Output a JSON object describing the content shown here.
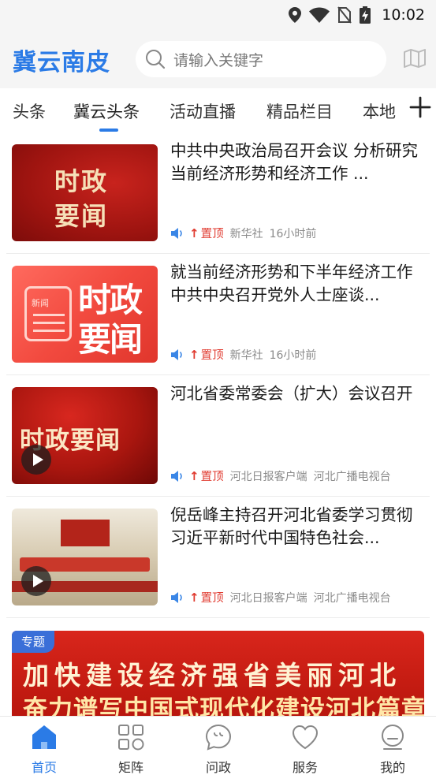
{
  "status_bar": {
    "time": "10:02"
  },
  "header": {
    "app_title": "冀云南皮",
    "search_placeholder": "请输入关键字"
  },
  "tabs": [
    {
      "label": "头条"
    },
    {
      "label": "冀云头条",
      "active": true
    },
    {
      "label": "活动直播"
    },
    {
      "label": "精品栏目"
    },
    {
      "label": "本地"
    }
  ],
  "news": [
    {
      "title": "中共中央政治局召开会议 分析研究当前经济形势和经济工作 ...",
      "thumb_text": [
        "时政",
        "要闻"
      ],
      "pin_label": "置顶",
      "sources": [
        "新华社",
        "16小时前"
      ]
    },
    {
      "title": "就当前经济形势和下半年经济工作 中共中央召开党外人士座谈...",
      "thumb_text": [
        "新闻",
        "时政",
        "要闻"
      ],
      "pin_label": "置顶",
      "sources": [
        "新华社",
        "16小时前"
      ]
    },
    {
      "title": "河北省委常委会（扩大）会议召开",
      "thumb_text": [
        "时政要闻"
      ],
      "pin_label": "置顶",
      "sources": [
        "河北日报客户端",
        "河北广播电视台"
      ]
    },
    {
      "title": "倪岳峰主持召开河北省委学习贯彻习近平新时代中国特色社会...",
      "thumb_text": [],
      "pin_label": "置顶",
      "sources": [
        "河北日报客户端",
        "河北广播电视台"
      ]
    }
  ],
  "banner": {
    "tag": "专题",
    "line1": "加快建设经济强省美丽河北",
    "line2": "奋力谱写中国式现代化建设河北篇章"
  },
  "bottom_nav": [
    {
      "label": "首页",
      "icon": "home-icon",
      "active": true
    },
    {
      "label": "矩阵",
      "icon": "grid-icon"
    },
    {
      "label": "问政",
      "icon": "chat-icon"
    },
    {
      "label": "服务",
      "icon": "heart-icon"
    },
    {
      "label": "我的",
      "icon": "profile-icon"
    }
  ],
  "colors": {
    "accent": "#2b7be6",
    "pin": "#e03a2f"
  }
}
